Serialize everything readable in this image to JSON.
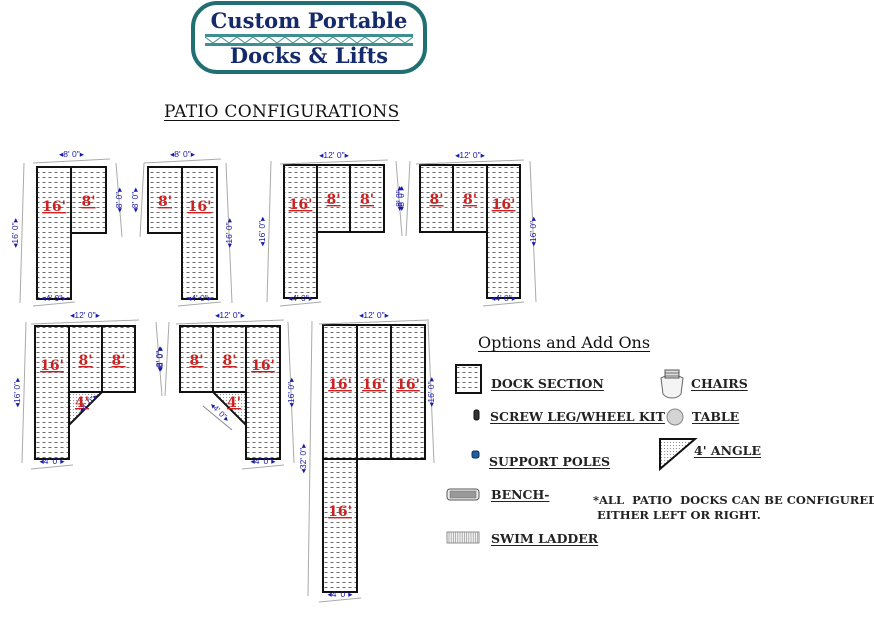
{
  "logo": {
    "line1": "Custom Portable",
    "line2": "Docks & Lifts",
    "text_color": "#152a6b",
    "border_color": "#1f6f73"
  },
  "title": "PATIO CONFIGURATIONS",
  "colors": {
    "section_label": "#cc2222",
    "dimension_text": "#1a1aa8",
    "outline": "#111111",
    "hatch": "#555555"
  },
  "configurations": [
    {
      "id": "config-1",
      "sections": [
        {
          "label": "16'",
          "size": "4x16"
        },
        {
          "label": "8'",
          "size": "4x8"
        }
      ],
      "dimensions": {
        "top": "8' 0\"",
        "bottom": "4' 0\"",
        "left": "16' 0\"",
        "right": "8' 0\""
      }
    },
    {
      "id": "config-2",
      "sections": [
        {
          "label": "8'",
          "size": "4x8"
        },
        {
          "label": "16'",
          "size": "4x16"
        }
      ],
      "dimensions": {
        "top": "8' 0\"",
        "bottom": "4' 0\"",
        "left": "8' 0\"",
        "right": "16' 0\""
      }
    },
    {
      "id": "config-3",
      "sections": [
        {
          "label": "16'",
          "size": "4x16"
        },
        {
          "label": "8'",
          "size": "4x8"
        },
        {
          "label": "8'",
          "size": "4x8"
        }
      ],
      "dimensions": {
        "top": "12' 0\"",
        "bottom": "4' 0\"",
        "left": "16' 0\"",
        "right": "8' 0\""
      }
    },
    {
      "id": "config-4",
      "sections": [
        {
          "label": "8'",
          "size": "4x8"
        },
        {
          "label": "8'",
          "size": "4x8"
        },
        {
          "label": "16'",
          "size": "4x16"
        }
      ],
      "dimensions": {
        "top": "12' 0\"",
        "bottom": "4' 0\"",
        "left": "8' 0\"",
        "right": "16' 0\""
      }
    },
    {
      "id": "config-5",
      "sections": [
        {
          "label": "16'",
          "size": "4x16"
        },
        {
          "label": "8'",
          "size": "4x8"
        },
        {
          "label": "8'",
          "size": "4x8"
        },
        {
          "label": "4'",
          "size": "4' angle"
        }
      ],
      "dimensions": {
        "top": "12' 0\"",
        "bottom": "4' 0\"",
        "left": "16' 0\"",
        "right": "8' 0\"",
        "angle": "4' 0\""
      }
    },
    {
      "id": "config-6",
      "sections": [
        {
          "label": "8'",
          "size": "4x8"
        },
        {
          "label": "8'",
          "size": "4x8"
        },
        {
          "label": "16'",
          "size": "4x16"
        },
        {
          "label": "4'",
          "size": "4' angle"
        }
      ],
      "dimensions": {
        "top": "12' 0\"",
        "bottom": "4' 0\"",
        "left": "8' 0\"",
        "right": "16' 0\"",
        "angle": "4' 0\""
      }
    },
    {
      "id": "config-7",
      "sections": [
        {
          "label": "16'",
          "size": "4x16"
        },
        {
          "label": "16'",
          "size": "4x16"
        },
        {
          "label": "16'",
          "size": "4x16"
        },
        {
          "label": "16'",
          "size": "4x16"
        }
      ],
      "dimensions": {
        "top": "12' 0\"",
        "bottom": "4' 0\"",
        "left": "32' 0\"",
        "right": "16' 0\""
      }
    }
  ],
  "options": {
    "title": "Options and Add Ons",
    "items": [
      {
        "label": "DOCK SECTION",
        "icon": "dock-section-icon"
      },
      {
        "label": "SCREW LEG/WHEEL KIT",
        "icon": "screw-leg-icon"
      },
      {
        "label": "SUPPORT POLES",
        "icon": "support-pole-icon"
      },
      {
        "label": "BENCH-",
        "icon": "bench-icon"
      },
      {
        "label": "SWIM LADDER",
        "icon": "swim-ladder-icon"
      },
      {
        "label": "CHAIRS",
        "icon": "chair-icon"
      },
      {
        "label": "TABLE",
        "icon": "table-icon"
      },
      {
        "label": "4' ANGLE",
        "icon": "angle-icon"
      }
    ],
    "note": "*ALL  PATIO  DOCKS CAN BE CONFIGURED\n EITHER LEFT OR RIGHT."
  }
}
